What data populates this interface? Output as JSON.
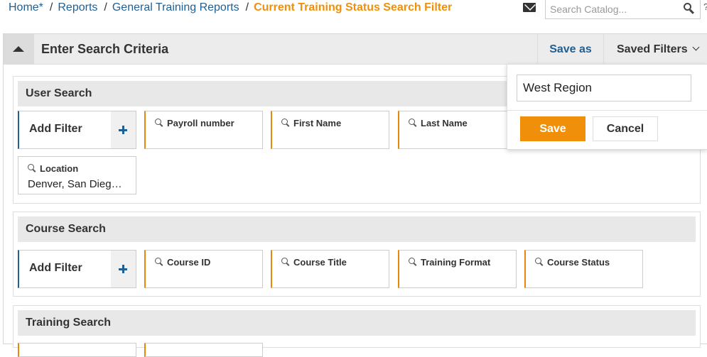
{
  "breadcrumb": {
    "items": [
      "Home*",
      "Reports",
      "General Training Reports"
    ],
    "current": "Current Training Status Search Filter",
    "separator": "/"
  },
  "header": {
    "search_placeholder": "Search Catalog...",
    "edge_text": "?"
  },
  "panel": {
    "title": "Enter Search Criteria",
    "save_as_label": "Save as",
    "saved_filters_label": "Saved Filters"
  },
  "user_search": {
    "title": "User Search",
    "add_filter_label": "Add Filter",
    "filters": [
      {
        "label": "Payroll number",
        "value": ""
      },
      {
        "label": "First Name",
        "value": ""
      },
      {
        "label": "Last Name",
        "value": ""
      },
      {
        "label": "Location",
        "value": "Denver, San Dieg…"
      }
    ]
  },
  "course_search": {
    "title": "Course Search",
    "add_filter_label": "Add Filter",
    "filters": [
      {
        "label": "Course ID"
      },
      {
        "label": "Course Title"
      },
      {
        "label": "Training Format"
      },
      {
        "label": "Course Status"
      }
    ]
  },
  "training_search": {
    "title": "Training Search"
  },
  "save_popover": {
    "name_value": "West Region",
    "save_label": "Save",
    "cancel_label": "Cancel"
  },
  "colors": {
    "link_blue": "#1f5f93",
    "accent_orange": "#f0900a"
  }
}
